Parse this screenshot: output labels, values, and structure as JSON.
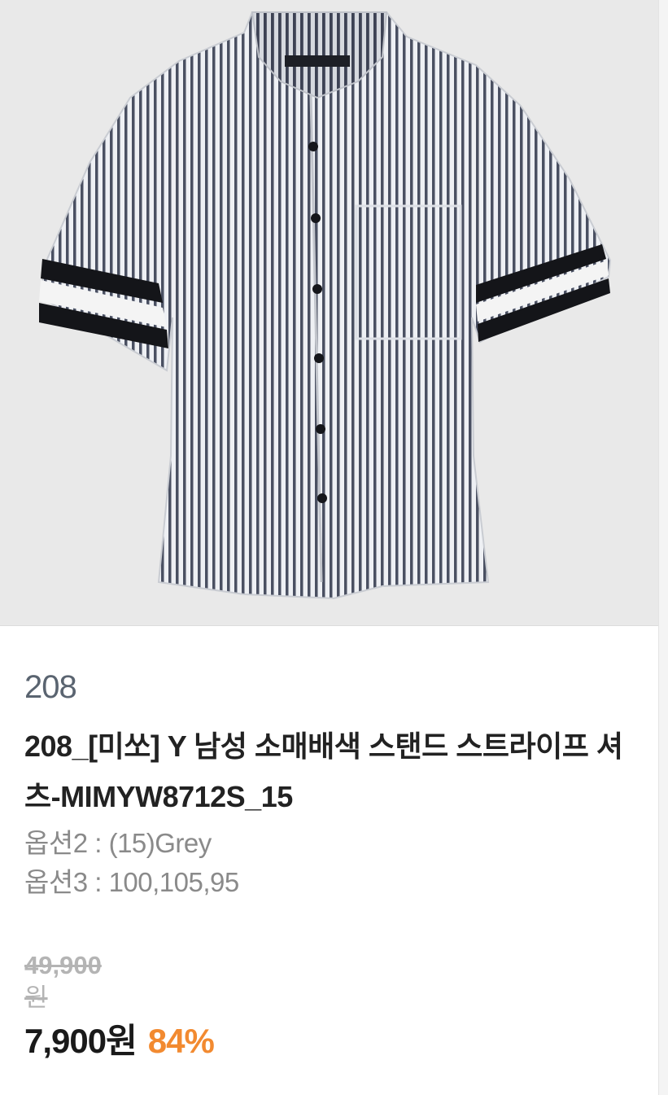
{
  "product": {
    "image_alt": "striped short-sleeve shirt",
    "brand": "208",
    "title": "208_[미쏘] Y 남성 소매배색 스탠드 스트라이프 셔츠-MIMYW8712S_15",
    "options": [
      "옵션2 : (15)Grey",
      "옵션3 : 100,105,95"
    ],
    "original_price": "49,900",
    "original_price_unit": "원",
    "sale_price": "7,900원",
    "discount_rate": "84%"
  },
  "colors": {
    "image_bg": "#e9e9e9",
    "brand": "#5a6470",
    "title": "#222222",
    "option": "#8a8a8a",
    "original_price": "#b4b4b4",
    "sale_price": "#1a1a1a",
    "discount": "#f28a30"
  }
}
